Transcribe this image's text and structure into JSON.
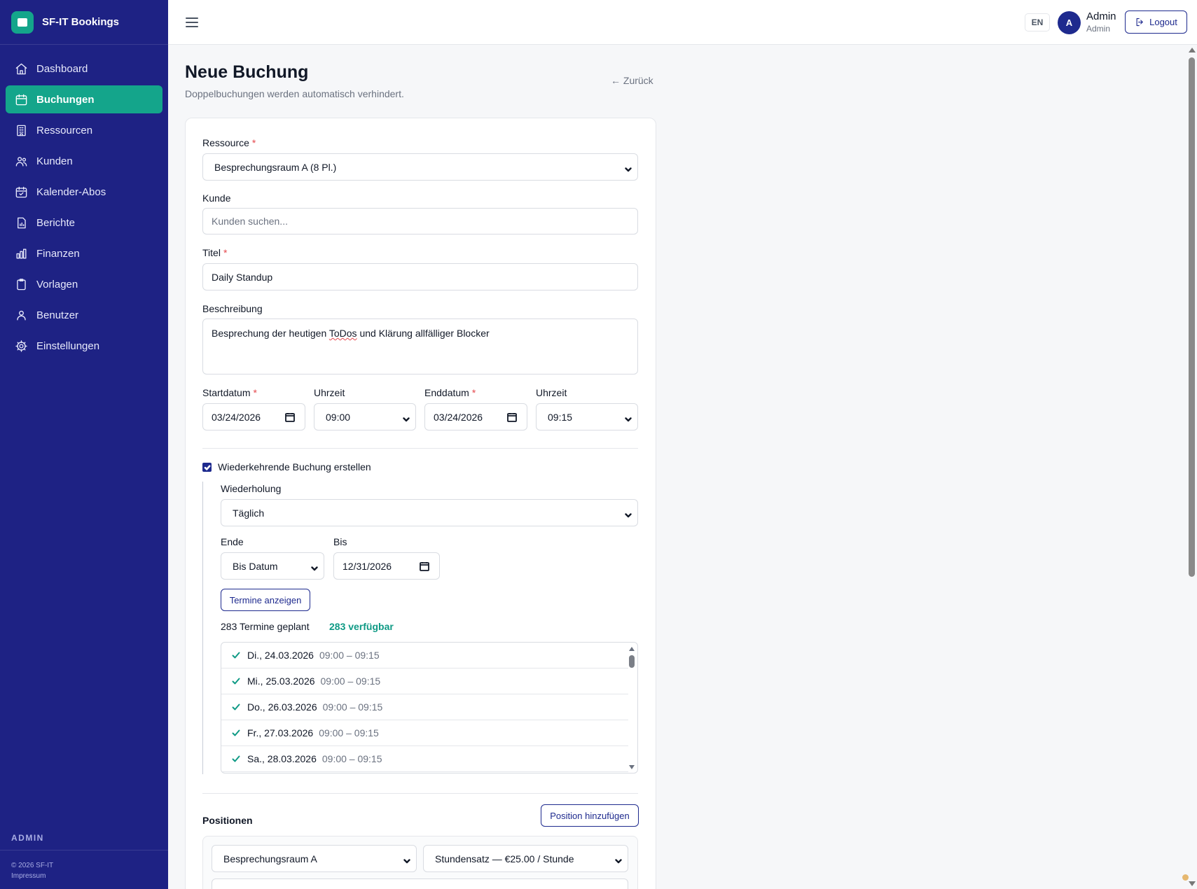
{
  "brand": {
    "name": "SF-IT Bookings",
    "accent": "#14a58b",
    "sidebar_bg": "#1e2284"
  },
  "sidebar": {
    "items": [
      {
        "label": "Dashboard",
        "icon": "home-icon"
      },
      {
        "label": "Buchungen",
        "icon": "calendar-icon",
        "active": true
      },
      {
        "label": "Ressourcen",
        "icon": "building-icon"
      },
      {
        "label": "Kunden",
        "icon": "users-icon"
      },
      {
        "label": "Kalender-Abos",
        "icon": "calendar-check-icon"
      },
      {
        "label": "Berichte",
        "icon": "report-icon"
      },
      {
        "label": "Finanzen",
        "icon": "bar-chart-icon"
      },
      {
        "label": "Vorlagen",
        "icon": "clipboard-icon"
      },
      {
        "label": "Benutzer",
        "icon": "user-group-icon"
      },
      {
        "label": "Einstellungen",
        "icon": "gear-icon"
      }
    ],
    "role_label": "ADMIN",
    "footer_copyright": "© 2026 SF-IT",
    "footer_link": "Impressum"
  },
  "topbar": {
    "language": "EN",
    "avatar_initial": "A",
    "user_name": "Admin",
    "user_role": "Admin",
    "logout_label": "Logout"
  },
  "page": {
    "title": "Neue Buchung",
    "subtitle": "Doppelbuchungen werden automatisch verhindert.",
    "back_label": "← Zurück"
  },
  "form": {
    "resource": {
      "label": "Ressource",
      "value": "Besprechungsraum A (8 Pl.)"
    },
    "customer": {
      "label": "Kunde",
      "placeholder": "Kunden suchen..."
    },
    "title": {
      "label": "Titel",
      "value": "Daily Standup"
    },
    "description": {
      "label": "Beschreibung",
      "text_before": "Besprechung der heutigen ",
      "text_flagged": "ToDos",
      "text_after": " und Klärung allfälliger Blocker"
    },
    "start_date": {
      "label": "Startdatum",
      "value": "03/24/2026"
    },
    "start_time": {
      "label": "Uhrzeit",
      "value": "09:00"
    },
    "end_date": {
      "label": "Enddatum",
      "value": "03/24/2026"
    },
    "end_time": {
      "label": "Uhrzeit",
      "value": "09:15"
    },
    "required_mark": "*"
  },
  "recurrence": {
    "checkbox_label": "Wiederkehrende Buchung erstellen",
    "checked": true,
    "repeat": {
      "label": "Wiederholung",
      "value": "Täglich"
    },
    "end": {
      "label": "Ende",
      "value": "Bis Datum"
    },
    "until": {
      "label": "Bis",
      "value": "12/31/2026"
    },
    "show_button": "Termine anzeigen",
    "planned_count": "283 Termine geplant",
    "available_count": "283 verfügbar",
    "occurrences": [
      {
        "date": "Di., 24.03.2026",
        "time": "09:00 – 09:15"
      },
      {
        "date": "Mi., 25.03.2026",
        "time": "09:00 – 09:15"
      },
      {
        "date": "Do., 26.03.2026",
        "time": "09:00 – 09:15"
      },
      {
        "date": "Fr., 27.03.2026",
        "time": "09:00 – 09:15"
      },
      {
        "date": "Sa., 28.03.2026",
        "time": "09:00 – 09:15"
      }
    ]
  },
  "positions": {
    "title": "Positionen",
    "add_button": "Position hinzufügen",
    "item": {
      "resource": "Besprechungsraum A",
      "rate": "Stundensatz — €25.00 / Stunde"
    }
  }
}
